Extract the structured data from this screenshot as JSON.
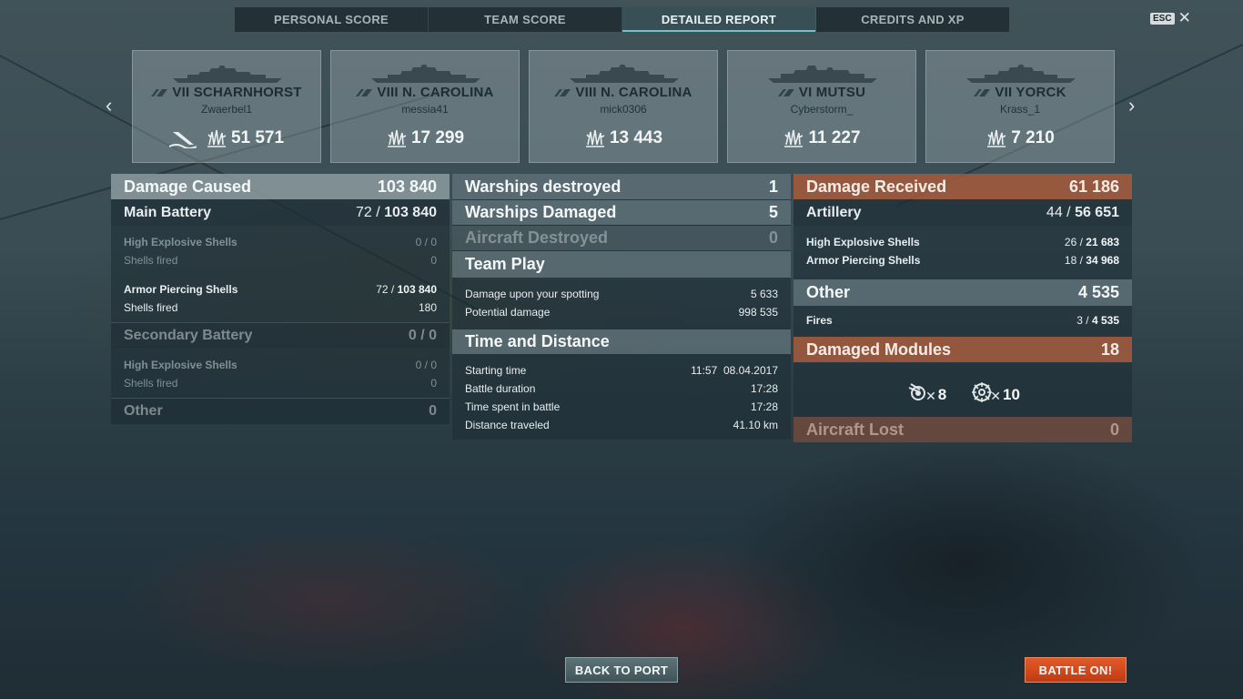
{
  "tabs": [
    {
      "label": "PERSONAL SCORE"
    },
    {
      "label": "TEAM SCORE"
    },
    {
      "label": "DETAILED REPORT"
    },
    {
      "label": "CREDITS AND XP"
    }
  ],
  "active_tab": 2,
  "esc": {
    "key": "ESC",
    "close": "✕"
  },
  "nav": {
    "prev": "‹",
    "next": "›"
  },
  "ships": [
    {
      "name": "VII SCHARNHORST",
      "player": "Zwaerbel1",
      "damage": "51 571",
      "sunk": true,
      "icons": [
        "battleship-icon",
        "damage-icon",
        "ship-sunk-icon"
      ]
    },
    {
      "name": "VIII N. CAROLINA",
      "player": "messia41",
      "damage": "17 299",
      "sunk": false
    },
    {
      "name": "VIII N. CAROLINA",
      "player": "mick0306",
      "damage": "13 443",
      "sunk": false
    },
    {
      "name": "VI MUTSU",
      "player": "Cyberstorm_",
      "damage": "11 227",
      "sunk": false
    },
    {
      "name": "VII YORCK",
      "player": "Krass_1",
      "damage": "7 210",
      "sunk": false
    }
  ],
  "damage_caused": {
    "title": "Damage Caused",
    "value": "103 840",
    "main_battery": {
      "title": "Main Battery",
      "hits": "72",
      "value": "103 840"
    },
    "mb_he": {
      "label": "High Explosive Shells",
      "hits": "0",
      "value": "0"
    },
    "mb_he_fired": {
      "label": "Shells fired",
      "value": "0"
    },
    "mb_ap": {
      "label": "Armor Piercing Shells",
      "hits": "72",
      "value": "103 840"
    },
    "mb_ap_fired": {
      "label": "Shells fired",
      "value": "180"
    },
    "secondary": {
      "title": "Secondary Battery",
      "hits": "0",
      "value": "0"
    },
    "sec_he": {
      "label": "High Explosive Shells",
      "hits": "0",
      "value": "0"
    },
    "sec_he_fired": {
      "label": "Shells fired",
      "value": "0"
    },
    "other": {
      "title": "Other",
      "value": "0"
    }
  },
  "middle": {
    "destroyed": {
      "label": "Warships destroyed",
      "value": "1"
    },
    "damaged": {
      "label": "Warships Damaged",
      "value": "5"
    },
    "aircraft": {
      "label": "Aircraft Destroyed",
      "value": "0"
    },
    "team_play": {
      "title": "Team Play"
    },
    "spotting": {
      "label": "Damage upon your spotting",
      "value": "5 633"
    },
    "potential": {
      "label": "Potential damage",
      "value": "998 535"
    },
    "time_distance": {
      "title": "Time and Distance"
    },
    "start": {
      "label": "Starting time",
      "time": "11:57",
      "date": "08.04.2017"
    },
    "duration": {
      "label": "Battle duration",
      "value": "17:28"
    },
    "spent": {
      "label": "Time spent in battle",
      "value": "17:28"
    },
    "distance": {
      "label": "Distance traveled",
      "value": "41.10 km"
    }
  },
  "damage_received": {
    "title": "Damage Received",
    "value": "61 186",
    "artillery": {
      "title": "Artillery",
      "hits": "44",
      "value": "56 651"
    },
    "he": {
      "label": "High Explosive Shells",
      "hits": "26",
      "value": "21 683"
    },
    "ap": {
      "label": "Armor Piercing Shells",
      "hits": "18",
      "value": "34 968"
    },
    "other": {
      "title": "Other",
      "value": "4 535"
    },
    "fires": {
      "label": "Fires",
      "hits": "3",
      "value": "4 535"
    },
    "modules": {
      "title": "Damaged Modules",
      "value": "18"
    },
    "module_items": [
      {
        "icon": "turret-module-icon",
        "count": "8"
      },
      {
        "icon": "steering-module-icon",
        "count": "10"
      }
    ],
    "aircraft_lost": {
      "title": "Aircraft Lost",
      "value": "0"
    }
  },
  "buttons": {
    "back": "BACK TO PORT",
    "battle": "BATTLE ON!"
  },
  "colors": {
    "accent_teal": "#6fc4c8",
    "received_orange": "#aa5c3c",
    "battle_button": "#d04a1c"
  }
}
